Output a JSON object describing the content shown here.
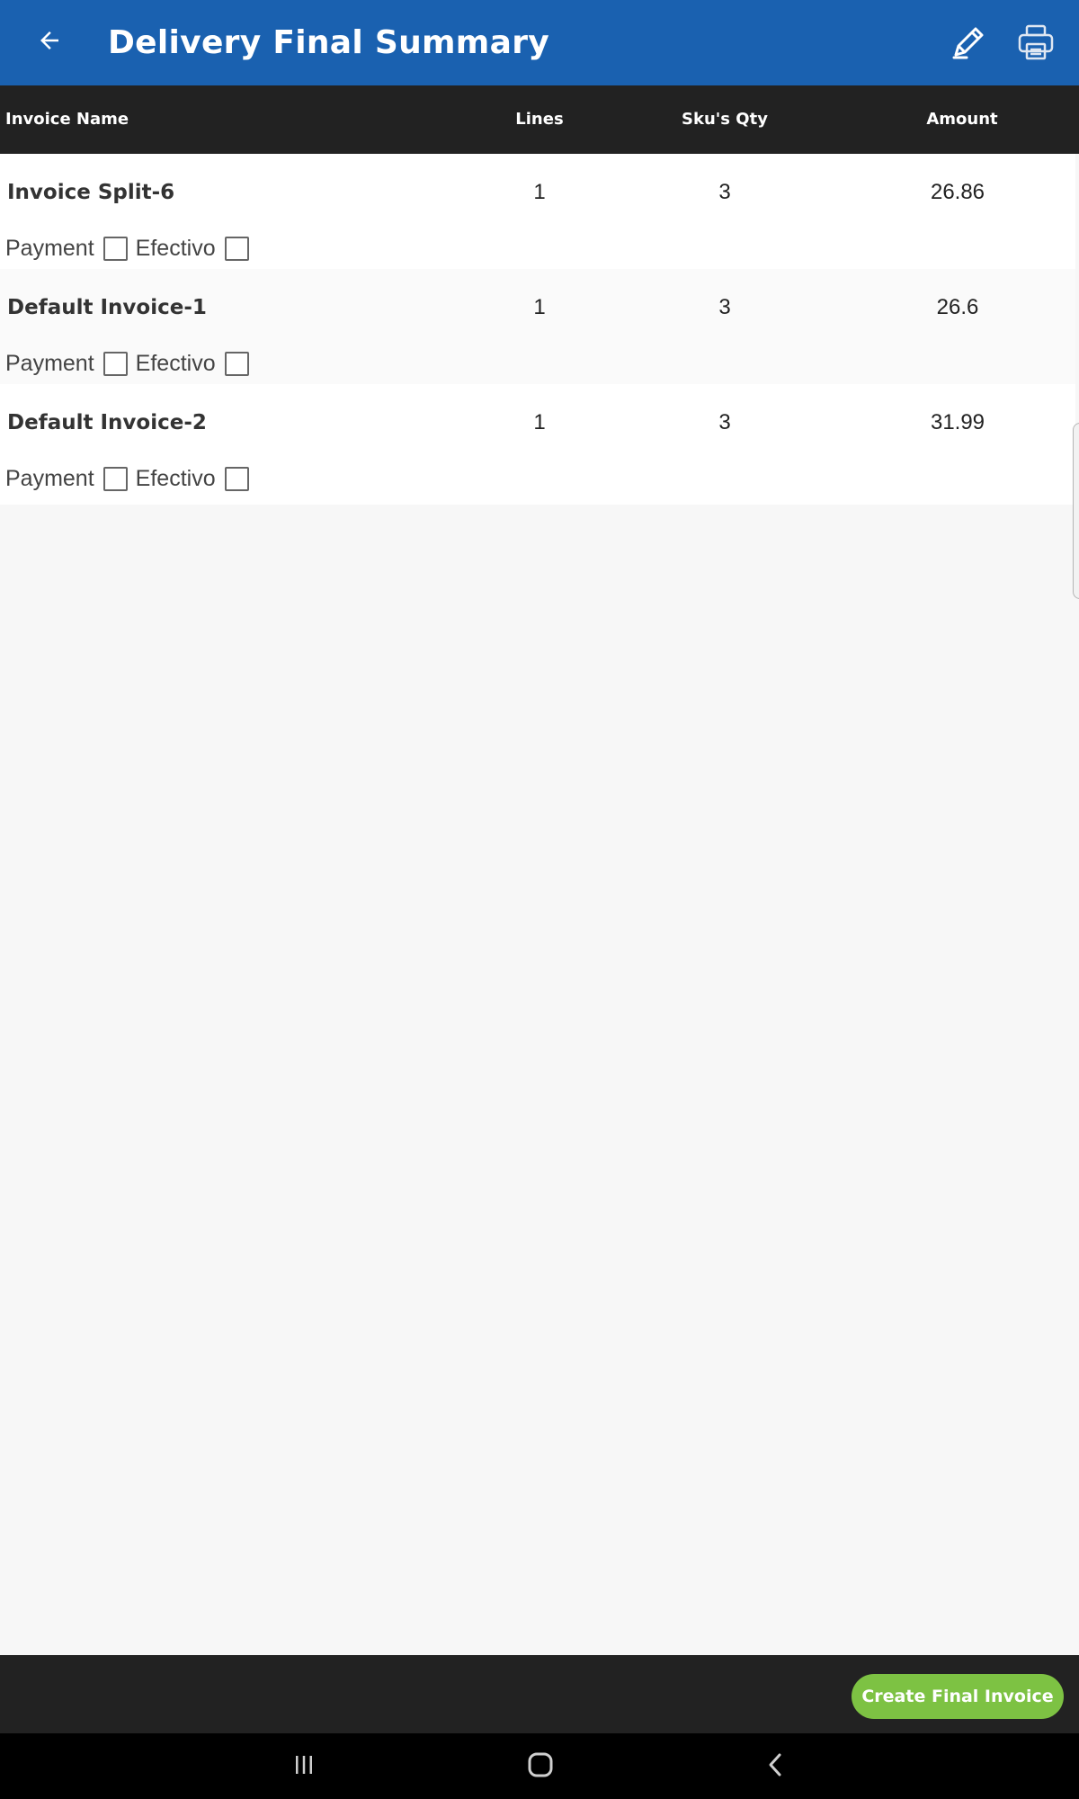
{
  "app_bar": {
    "title": "Delivery Final Summary",
    "back_icon": "arrow-back-icon",
    "edit_icon": "pencil-icon",
    "print_icon": "printer-icon",
    "background_color": "#1a61b0"
  },
  "table": {
    "columns": {
      "name": "Invoice Name",
      "lines": "Lines",
      "qty": "Sku's Qty",
      "amount": "Amount"
    },
    "rows": [
      {
        "name": "Invoice Split-6",
        "lines": "1",
        "qty": "3",
        "amount": "26.86",
        "payment_label": "Payment",
        "efectivo_label": "Efectivo",
        "payment_checked": false,
        "efectivo_checked": false
      },
      {
        "name": "Default Invoice-1",
        "lines": "1",
        "qty": "3",
        "amount": "26.6",
        "payment_label": "Payment",
        "efectivo_label": "Efectivo",
        "payment_checked": false,
        "efectivo_checked": false
      },
      {
        "name": "Default Invoice-2",
        "lines": "1",
        "qty": "3",
        "amount": "31.99",
        "payment_label": "Payment",
        "efectivo_label": "Efectivo",
        "payment_checked": false,
        "efectivo_checked": false
      }
    ]
  },
  "footer": {
    "create_button_label": "Create Final Invoice",
    "button_color": "#7dc243"
  },
  "nav": {
    "recents_icon": "recents-icon",
    "home_icon": "home-icon",
    "back_icon": "nav-back-icon"
  }
}
